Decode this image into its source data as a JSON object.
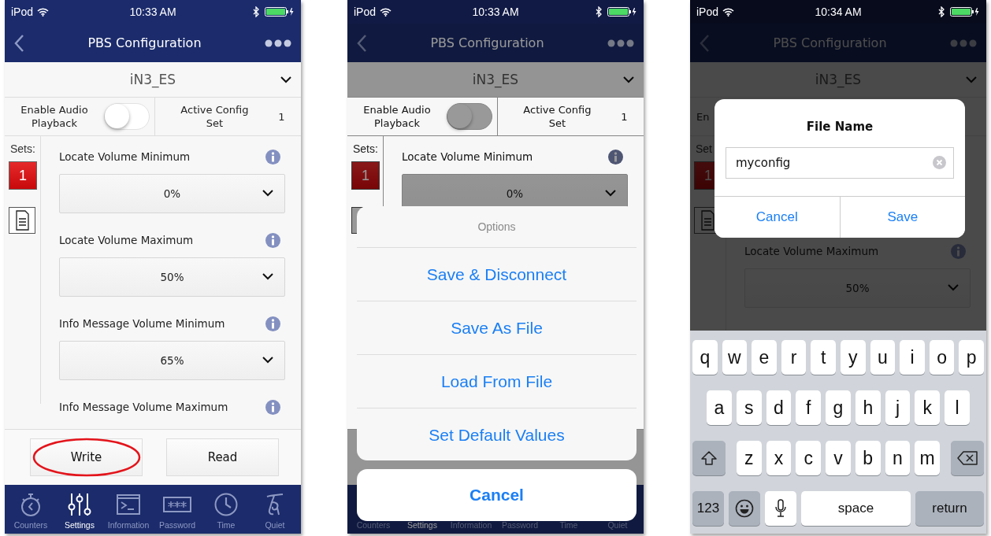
{
  "screens": [
    {
      "kind": "main",
      "status_bar": {
        "carrier": "iPod",
        "time": "10:33 AM"
      },
      "nav": {
        "title": "PBS Configuration"
      },
      "device": {
        "name": "iN3_ES"
      },
      "audio": {
        "label": "Enable Audio Playback",
        "on": false
      },
      "active_config": {
        "label": "Active Config Set",
        "value": "1"
      },
      "sets": {
        "label": "Sets:",
        "items": [
          {
            "label": "1",
            "selected": true
          }
        ]
      },
      "settings": [
        {
          "label": "Locate Volume Minimum",
          "value": "0%"
        },
        {
          "label": "Locate Volume Maximum",
          "value": "50%"
        },
        {
          "label": "Info Message Volume Minimum",
          "value": "65%"
        },
        {
          "label": "Info Message Volume Maximum"
        }
      ],
      "buttons": [
        {
          "label": "Write",
          "circled": true
        },
        {
          "label": "Read",
          "circled": false
        }
      ],
      "tabs": [
        {
          "label": "Counters",
          "kind": "stopwatch",
          "selected": false
        },
        {
          "label": "Settings",
          "kind": "sliders",
          "selected": true
        },
        {
          "label": "Information",
          "kind": "terminal",
          "selected": false
        },
        {
          "label": "Password",
          "kind": "password",
          "selected": false
        },
        {
          "label": "Time",
          "kind": "clock",
          "selected": false
        },
        {
          "label": "Quiet",
          "kind": "figure",
          "selected": false
        }
      ]
    },
    {
      "kind": "action_sheet",
      "status_bar": {
        "carrier": "iPod",
        "time": "10:33 AM"
      },
      "nav": {
        "title": "PBS Configuration"
      },
      "device": {
        "name": "iN3_ES"
      },
      "audio": {
        "label": "Enable Audio Playback",
        "on": false
      },
      "active_config": {
        "label": "Active Config Set",
        "value": "1"
      },
      "sets": {
        "label": "Sets:",
        "items": [
          {
            "label": "1",
            "selected": true
          }
        ]
      },
      "settings": [
        {
          "label": "Locate Volume Minimum",
          "value": "0%"
        }
      ],
      "tabs": [
        {
          "label": "Counters",
          "selected": false
        },
        {
          "label": "Settings",
          "selected": true
        },
        {
          "label": "Information",
          "selected": false
        },
        {
          "label": "Password",
          "selected": false
        },
        {
          "label": "Time",
          "selected": false
        },
        {
          "label": "Quiet",
          "selected": false
        }
      ],
      "sheet": {
        "title": "Options",
        "actions": [
          "Save & Disconnect",
          "Save As File",
          "Load From File",
          "Set Default Values"
        ],
        "cancel": "Cancel"
      }
    },
    {
      "kind": "dialog",
      "status_bar": {
        "carrier": "iPod",
        "time": "10:34 AM"
      },
      "nav": {
        "title": "PBS Configuration"
      },
      "device": {
        "name": "iN3_ES"
      },
      "audio": {
        "label": "En"
      },
      "sets": {
        "label": "Set",
        "items": [
          {
            "label": "1",
            "selected": true
          }
        ]
      },
      "settings": [
        {
          "label": "Locate Volume Maximum",
          "value": "50%"
        }
      ],
      "dialog": {
        "title": "File Name",
        "value": "myconfig",
        "buttons": [
          "Cancel",
          "Save"
        ]
      },
      "keyboard": {
        "rows": [
          {
            "keys": [
              {
                "kind": "letter",
                "label": "q"
              },
              {
                "kind": "letter",
                "label": "w"
              },
              {
                "kind": "letter",
                "label": "e"
              },
              {
                "kind": "letter",
                "label": "r"
              },
              {
                "kind": "letter",
                "label": "t"
              },
              {
                "kind": "letter",
                "label": "y"
              },
              {
                "kind": "letter",
                "label": "u"
              },
              {
                "kind": "letter",
                "label": "i"
              },
              {
                "kind": "letter",
                "label": "o"
              },
              {
                "kind": "letter",
                "label": "p"
              }
            ]
          },
          {
            "keys": [
              {
                "kind": "letter",
                "label": "a"
              },
              {
                "kind": "letter",
                "label": "s"
              },
              {
                "kind": "letter",
                "label": "d"
              },
              {
                "kind": "letter",
                "label": "f"
              },
              {
                "kind": "letter",
                "label": "g"
              },
              {
                "kind": "letter",
                "label": "h"
              },
              {
                "kind": "letter",
                "label": "j"
              },
              {
                "kind": "letter",
                "label": "k"
              },
              {
                "kind": "letter",
                "label": "l"
              }
            ]
          },
          {
            "keys": [
              {
                "kind": "shift"
              },
              {
                "kind": "letter",
                "label": "z"
              },
              {
                "kind": "letter",
                "label": "x"
              },
              {
                "kind": "letter",
                "label": "c"
              },
              {
                "kind": "letter",
                "label": "v"
              },
              {
                "kind": "letter",
                "label": "b"
              },
              {
                "kind": "letter",
                "label": "n"
              },
              {
                "kind": "letter",
                "label": "m"
              },
              {
                "kind": "delete"
              }
            ]
          },
          {
            "keys": [
              {
                "kind": "function",
                "label": "123"
              },
              {
                "kind": "emoji"
              },
              {
                "kind": "mic"
              },
              {
                "kind": "space",
                "label": "space"
              },
              {
                "kind": "function",
                "label": "return"
              }
            ]
          }
        ]
      }
    }
  ]
}
